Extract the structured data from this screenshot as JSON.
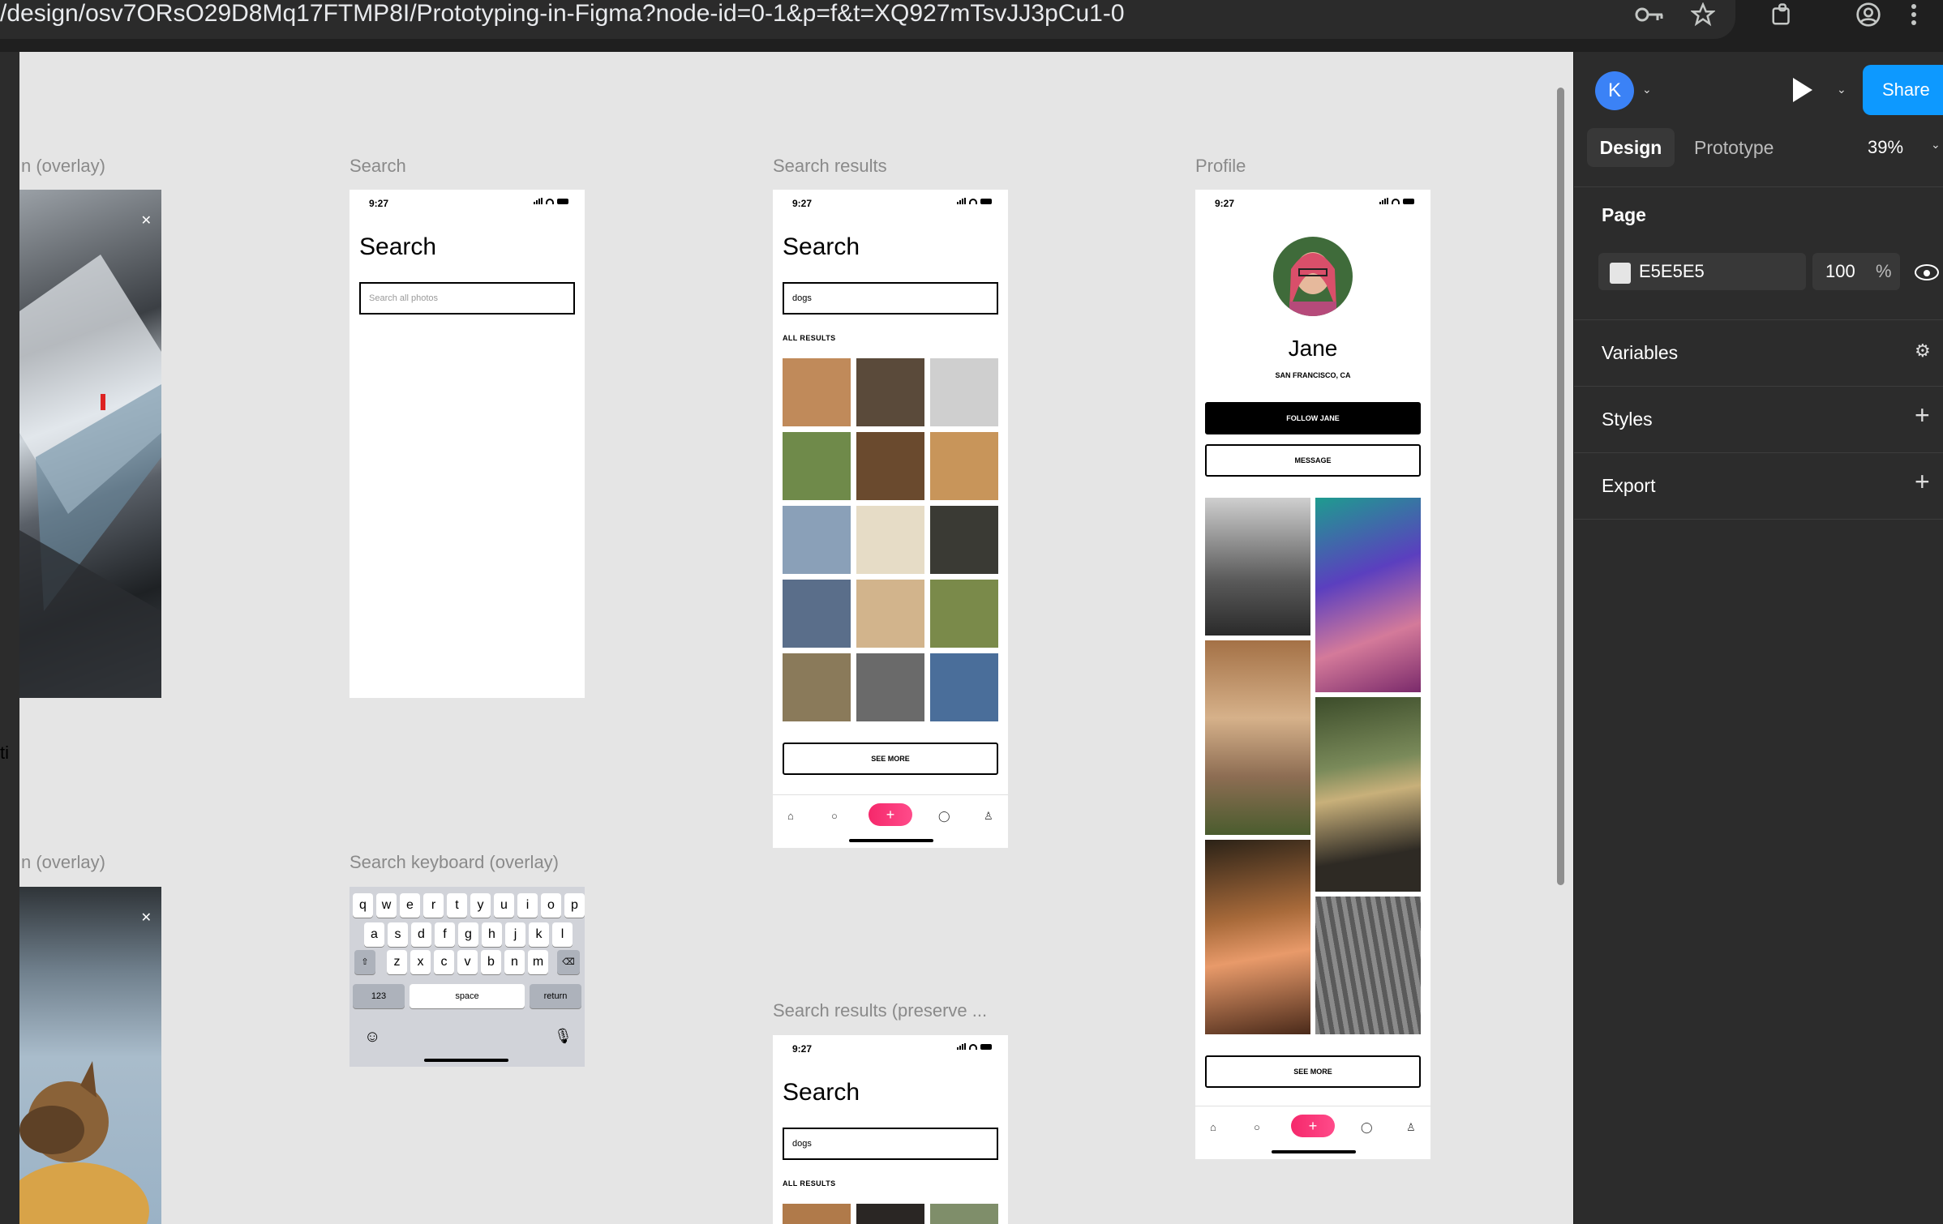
{
  "browser": {
    "url": "/design/osv7ORsO29D8Mq17FTMP8I/Prototyping-in-Figma?node-id=0-1&p=f&t=XQ927mTsvJJ3pCu1-0",
    "icons": [
      "key-icon",
      "star-icon",
      "extensions-icon",
      "profile-icon",
      "more-icon"
    ]
  },
  "canvas": {
    "background": "#E5E5E5",
    "labels": {
      "overlay_top": "n (overlay)",
      "search": "Search",
      "search_results": "Search results",
      "profile": "Profile",
      "overlay_bottom": "n (overlay)",
      "search_keyboard": "Search keyboard (overlay)",
      "search_results_preserve": "Search results (preserve ...",
      "cut_off_label": "ti"
    }
  },
  "phone": {
    "time": "9:27",
    "search_title": "Search",
    "search_placeholder": "Search all photos",
    "search_value": "dogs",
    "all_results": "ALL RESULTS",
    "see_more": "SEE MORE",
    "tab_plus": "+"
  },
  "profile": {
    "name": "Jane",
    "location": "SAN FRANCISCO, CA",
    "follow": "FOLLOW JANE",
    "message": "MESSAGE",
    "see_more": "SEE MORE"
  },
  "keyboard": {
    "row1": [
      "q",
      "w",
      "e",
      "r",
      "t",
      "y",
      "u",
      "i",
      "o",
      "p"
    ],
    "row2": [
      "a",
      "s",
      "d",
      "f",
      "g",
      "h",
      "j",
      "k",
      "l"
    ],
    "row3": [
      "z",
      "x",
      "c",
      "v",
      "b",
      "n",
      "m"
    ],
    "num": "123",
    "space": "space",
    "return": "return"
  },
  "panel": {
    "avatar_letter": "K",
    "share": "Share",
    "tab_design": "Design",
    "tab_prototype": "Prototype",
    "zoom": "39%",
    "page_title": "Page",
    "page_color": "E5E5E5",
    "page_opacity": "100",
    "percent": "%",
    "variables": "Variables",
    "styles": "Styles",
    "export": "Export"
  }
}
